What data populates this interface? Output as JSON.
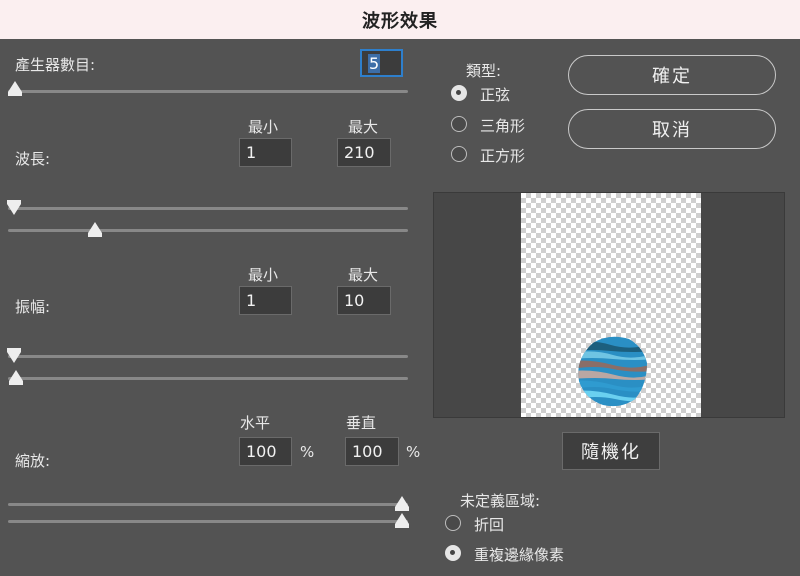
{
  "dialog": {
    "title": "波形效果"
  },
  "generators": {
    "label": "產生器數目:",
    "value": "5",
    "slider_fraction": 0.0
  },
  "wavelength": {
    "label": "波長:",
    "min_header": "最小",
    "max_header": "最大",
    "min": "1",
    "max": "210"
  },
  "amplitude": {
    "label": "振幅:",
    "min_header": "最小",
    "max_header": "最大",
    "min": "1",
    "max": "10"
  },
  "scale": {
    "label": "縮放:",
    "h_header": "水平",
    "v_header": "垂直",
    "h": "100",
    "v": "100",
    "unit": "%"
  },
  "type": {
    "label": "類型:",
    "options": [
      {
        "label": "正弦",
        "checked": true
      },
      {
        "label": "三角形",
        "checked": false
      },
      {
        "label": "正方形",
        "checked": false
      }
    ]
  },
  "buttons": {
    "ok": "確定",
    "cancel": "取消",
    "randomize": "隨機化"
  },
  "undefined_areas": {
    "label": "未定義區域:",
    "options": [
      {
        "label": "折回",
        "checked": false
      },
      {
        "label": "重複邊緣像素",
        "checked": true
      }
    ]
  },
  "colors": {
    "title_bg": "#fbeff0",
    "dialog_bg": "#535353",
    "focus": "#2e7fcc",
    "stone_blue": "#2a8fc4"
  }
}
